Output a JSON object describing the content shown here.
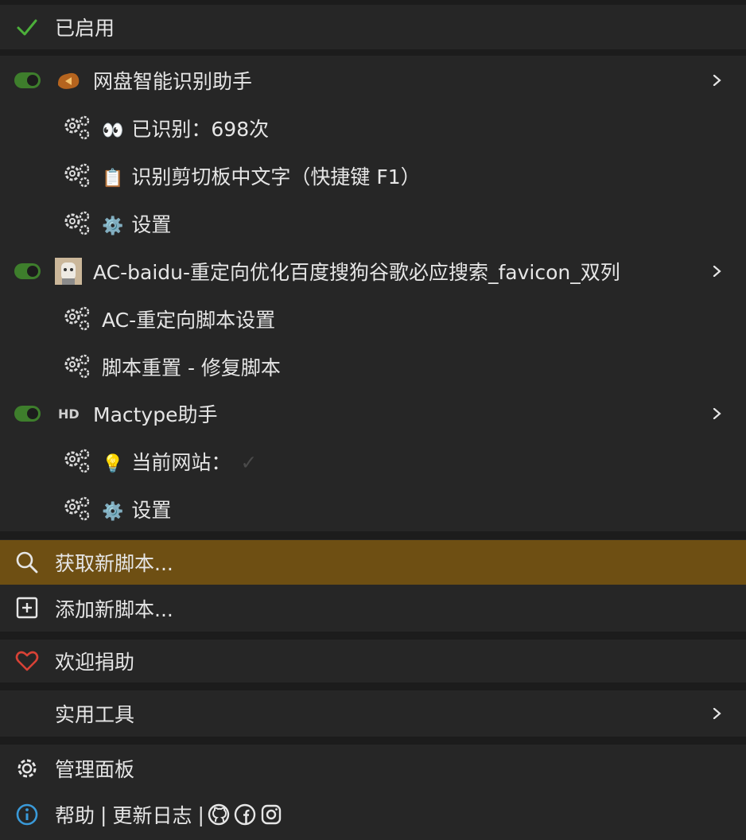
{
  "header": {
    "enabled_label": "已启用"
  },
  "scripts": [
    {
      "name": "网盘智能识别助手",
      "commands": [
        {
          "emoji": "👀",
          "label": "已识别：698次"
        },
        {
          "emoji": "📋",
          "label": "识别剪切板中文字（快捷键 F1）"
        },
        {
          "emoji": "⚙️",
          "label": "设置"
        }
      ]
    },
    {
      "name": "AC-baidu-重定向优化百度搜狗谷歌必应搜索_favicon_双列",
      "commands": [
        {
          "label": "AC-重定向脚本设置"
        },
        {
          "label": "脚本重置 - 修复脚本"
        }
      ]
    },
    {
      "name": "Mactype助手",
      "badge": "HD",
      "commands": [
        {
          "emoji": "💡",
          "label": "当前网站：",
          "suffix": "✓"
        },
        {
          "emoji": "⚙️",
          "label": "设置"
        }
      ]
    }
  ],
  "menu": {
    "find_new": "获取新脚本...",
    "add_new": "添加新脚本...",
    "donate": "欢迎捐助",
    "utilities": "实用工具",
    "dashboard": "管理面板",
    "help_parts": [
      "帮助",
      "|",
      "更新日志",
      "|"
    ]
  },
  "colors": {
    "highlight": "#6e4f13",
    "toggle_on": "#3e7e2c",
    "check": "#4caf3a",
    "heart": "#d84236",
    "info": "#3a9ad9"
  },
  "icons": [
    "checkmark-icon",
    "search-icon",
    "add-square-icon",
    "heart-icon",
    "gear-icon",
    "info-icon",
    "github-icon",
    "facebook-icon",
    "instagram-icon",
    "chevron-right-icon",
    "dual-gear-icon"
  ]
}
